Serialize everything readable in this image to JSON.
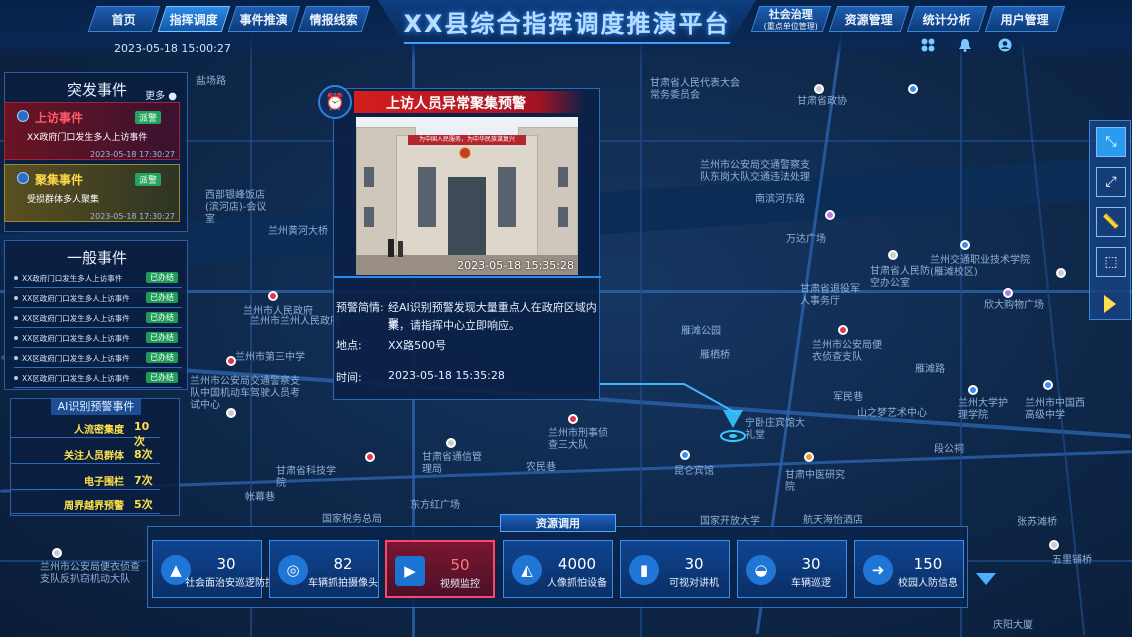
{
  "header": {
    "title": "XX县综合指挥调度推演平台",
    "datetime": "2023-05-18  15:00:27",
    "nav_left": [
      {
        "label": "首页",
        "active": false
      },
      {
        "label": "指挥调度",
        "active": true
      },
      {
        "label": "事件推演",
        "active": false
      },
      {
        "label": "情报线索",
        "active": false
      }
    ],
    "nav_right": [
      {
        "label": "社会治理",
        "sublabel": "(重点单位管理)"
      },
      {
        "label": "资源管理"
      },
      {
        "label": "统计分析"
      },
      {
        "label": "用户管理"
      }
    ],
    "icons": [
      "grid-icon",
      "bell-icon",
      "user-icon"
    ]
  },
  "urgent": {
    "title": "突发事件",
    "more": "更多",
    "items": [
      {
        "type": "上访事件",
        "badge": "派警",
        "desc": "XX政府门口发生多人上访事件",
        "time": "2023-05-18 17:30:27",
        "level": "red"
      },
      {
        "type": "聚集事件",
        "badge": "派警",
        "desc": "受损群体多人聚集",
        "time": "2023-05-18 17:30:27",
        "level": "yellow"
      }
    ]
  },
  "general": {
    "title": "一般事件",
    "items": [
      {
        "text": "XX政府门口发生多人上访事件",
        "status": "已办结"
      },
      {
        "text": "XX区政府门口发生多人上访事件",
        "status": "已办结"
      },
      {
        "text": "XX区政府门口发生多人上访事件",
        "status": "已办结"
      },
      {
        "text": "XX区政府门口发生多人上访事件",
        "status": "已办结"
      },
      {
        "text": "XX区政府门口发生多人上访事件",
        "status": "已办结"
      },
      {
        "text": "XX区政府门口发生多人上访事件",
        "status": "已办结"
      }
    ]
  },
  "ai": {
    "title": "AI识别预警事件",
    "items": [
      {
        "label": "人流密集度",
        "value": "10次"
      },
      {
        "label": "关注人员群体",
        "value": "8次"
      },
      {
        "label": "电子围栏",
        "value": "7次"
      },
      {
        "label": "周界越界预警",
        "value": "5次"
      }
    ]
  },
  "popup": {
    "title": "上访人员异常聚集预警",
    "photo_timestamp": "2023-05-18    15:35:28",
    "photo_banner": "为中国人民服务，为中华民族谋复兴",
    "brief_label": "预警简情:",
    "brief_text_1": "经AI识别预警发现大量重点人在政府区域内聚",
    "brief_text_2": "集，请指挥中心立即响应。",
    "location_label": "地点:",
    "location_value": "XX路500号",
    "time_label": "时间:",
    "time_value": "2023-05-18    15:35:28"
  },
  "tools": [
    "shrink-icon",
    "expand-icon",
    "ruler-icon",
    "select-box-icon"
  ],
  "resources": {
    "title": "资源调用",
    "items": [
      {
        "value": "30",
        "label": "社会面治安巡逻防控",
        "icon": "patrol-icon",
        "active": false
      },
      {
        "value": "82",
        "label": "车辆抓拍摄像头",
        "icon": "camera-icon",
        "active": false
      },
      {
        "value": "50",
        "label": "视频监控",
        "icon": "video-icon",
        "active": true
      },
      {
        "value": "4000",
        "label": "人像抓怕设备",
        "icon": "cctv-icon",
        "active": false
      },
      {
        "value": "30",
        "label": "可视对讲机",
        "icon": "walkie-talkie-icon",
        "active": false
      },
      {
        "value": "30",
        "label": "车辆巡逻",
        "icon": "car-icon",
        "active": false
      },
      {
        "value": "150",
        "label": "校园人防信息",
        "icon": "runner-icon",
        "active": false
      }
    ]
  },
  "map_labels": [
    "盐场路",
    "西部银峰饭店(滨河店)-会议室",
    "兰州黄河大桥",
    "兰州市人民政府",
    "兰州市第三中学",
    "甘肃省人民代表大会常务委员会",
    "甘肃省政协",
    "兰州市公安局交通警察支队东岗大队交通违法处理",
    "万达广场",
    "甘肃省人民防空办公室",
    "甘肃省退役军人事务厅",
    "兰州市公安局便衣侦查支队",
    "兰州交通职业技术学院(雁滩校区)",
    "欣大购物广场",
    "军民巷",
    "山之梦艺术中心",
    "兰州大学护理学院",
    "兰州市中国西高级中学",
    "段公祠",
    "甘肃中医研究院",
    "航天海怡酒店",
    "宁卧庄宾馆大礼堂",
    "雁滩公园",
    "雁栖桥",
    "张苏滩桥",
    "五里铺桥",
    "兰州市刑事侦查三大队",
    "甘肃省通信管理局",
    "甘肃省科技学院",
    "国家税务总局",
    "东方红广场",
    "帐幕巷",
    "兰州市公安局便衣侦查支队反扒窃机动大队",
    "农民巷",
    "昆仑宾馆",
    "国家开放大学",
    "兰州市公安局交通警察支队中国机动车驾驶人员考试中心",
    "雁滩路",
    "南滨河东路",
    "兰州市兰州人民政府",
    "庆阳大厦"
  ]
}
